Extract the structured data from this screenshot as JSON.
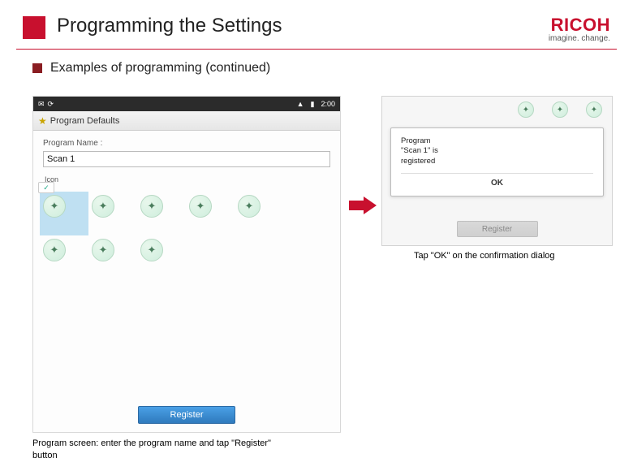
{
  "header": {
    "title": "Programming the Settings",
    "brand_name": "RICOH",
    "brand_slogan": "imagine. change."
  },
  "subtitle": "Examples of programming (continued)",
  "screen_a": {
    "status_time": "2:00",
    "window_title": "Program Defaults",
    "field_label": "Program Name :",
    "field_value": "Scan 1",
    "icon_label": "Icon",
    "register_label": "Register",
    "caption": "Program screen: enter the program name and tap \"Register\" button"
  },
  "screen_b": {
    "dialog_text": "Program\n\"Scan 1\" is\nregistered",
    "ok_label": "OK",
    "register_label": "Register",
    "caption": "Tap \"OK\" on the confirmation dialog"
  }
}
